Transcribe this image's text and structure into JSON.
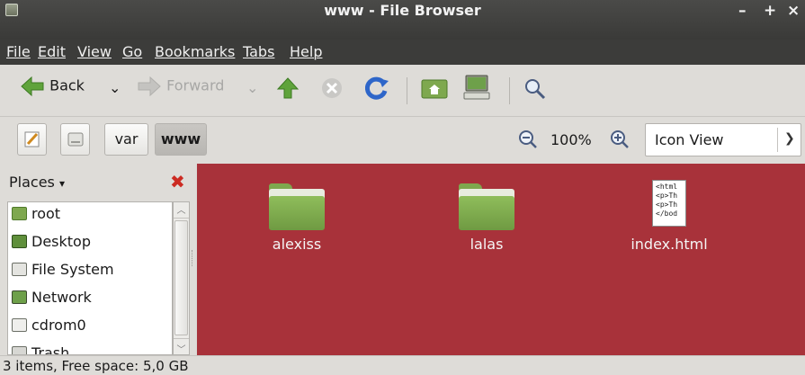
{
  "window": {
    "title": "www - File Browser",
    "controls": [
      "–",
      "+",
      "×"
    ]
  },
  "menubar": {
    "items": [
      "File",
      "Edit",
      "View",
      "Go",
      "Bookmarks",
      "Tabs",
      "Help"
    ]
  },
  "toolbar": {
    "back_label": "Back",
    "forward_label": "Forward",
    "dropdown_glyph": "⌄"
  },
  "pathbar": {
    "crumbs": [
      "var",
      "www"
    ],
    "zoom": "100%"
  },
  "view_selector": {
    "value": "Icon View"
  },
  "sidebar": {
    "header": "Places",
    "items": [
      {
        "label": "root",
        "icon": "home-folder-icon"
      },
      {
        "label": "Desktop",
        "icon": "desktop-icon"
      },
      {
        "label": "File System",
        "icon": "drive-icon"
      },
      {
        "label": "Network",
        "icon": "network-icon"
      },
      {
        "label": "cdrom0",
        "icon": "optical-drive-icon"
      },
      {
        "label": "Trash",
        "icon": "trash-icon"
      }
    ]
  },
  "files": [
    {
      "name": "alexiss",
      "type": "folder"
    },
    {
      "name": "lalas",
      "type": "folder"
    },
    {
      "name": "index.html",
      "type": "html",
      "preview": [
        "<html",
        "<p>Th",
        "<p>Th",
        "</bod"
      ]
    }
  ],
  "colors": {
    "content_background": "#a8323a",
    "folder_green": "#7ea84e",
    "titlebar": "#3c3c3a"
  },
  "status": {
    "text": "3 items, Free space: 5,0 GB"
  }
}
